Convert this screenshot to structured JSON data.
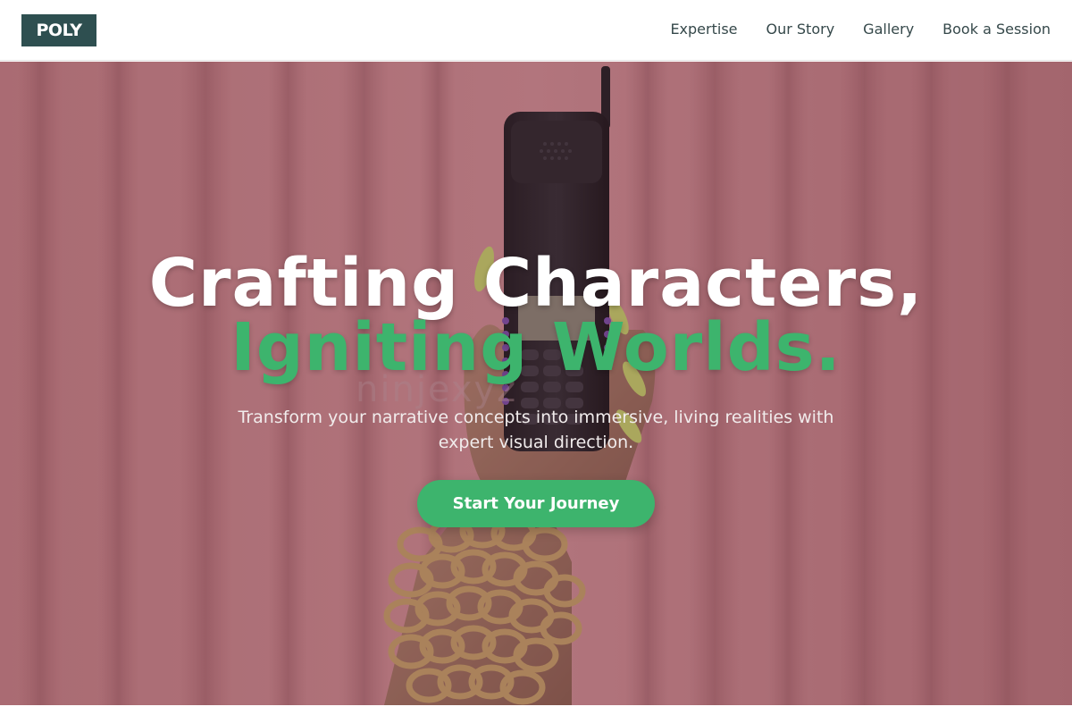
{
  "brand": {
    "logo_text": "POLY"
  },
  "nav": {
    "items": [
      {
        "label": "Expertise"
      },
      {
        "label": "Our Story"
      },
      {
        "label": "Gallery"
      },
      {
        "label": "Book a Session"
      }
    ]
  },
  "hero": {
    "title_line1": "Crafting Characters,",
    "title_line2": "Igniting Worlds.",
    "subtitle": "Transform your narrative concepts into immersive, living realities with expert visual direction.",
    "cta_label": "Start Your Journey",
    "watermark_text": "ninjexyz",
    "image": "hand-holding-retro-phone-with-gold-chain-bracelets-on-pink-curtain"
  },
  "colors": {
    "accent": "#3db46d",
    "logo_bg": "#2e4f50",
    "nav_text": "#35484a",
    "hero_bg": "#c98288"
  }
}
